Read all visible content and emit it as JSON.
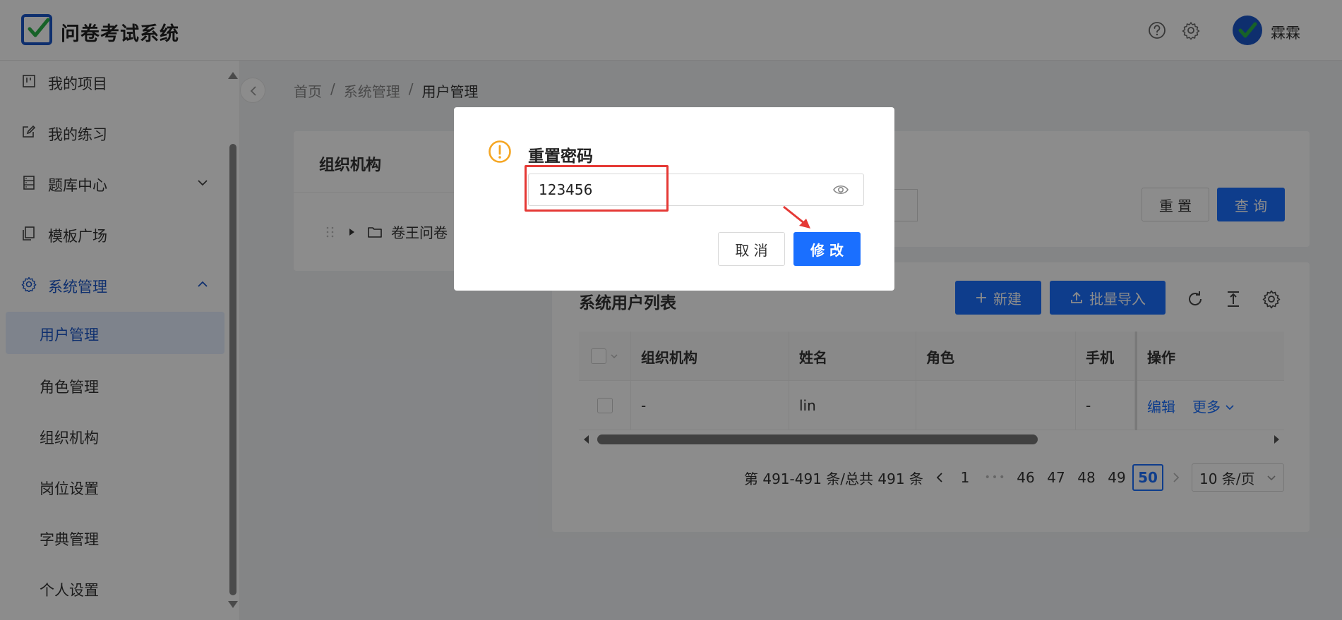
{
  "header": {
    "app_title": "问卷考试系统",
    "user_name": "霖霖"
  },
  "sidebar": {
    "items": [
      {
        "label": "我的项目"
      },
      {
        "label": "我的练习"
      },
      {
        "label": "题库中心"
      },
      {
        "label": "模板广场"
      },
      {
        "label": "系统管理"
      }
    ],
    "sub_items": [
      {
        "label": "用户管理"
      },
      {
        "label": "角色管理"
      },
      {
        "label": "组织机构"
      },
      {
        "label": "岗位设置"
      },
      {
        "label": "字典管理"
      },
      {
        "label": "个人设置"
      }
    ]
  },
  "breadcrumb": {
    "home": "首页",
    "sep": "/",
    "level1": "系统管理",
    "current": "用户管理"
  },
  "org_panel": {
    "title": "组织机构",
    "root_node": "卷王问卷"
  },
  "search": {
    "reset_label": "重 置",
    "query_label": "查 询"
  },
  "list": {
    "title": "系统用户列表",
    "new_label": "新建",
    "import_label": "批量导入"
  },
  "table": {
    "headers": [
      "组织机构",
      "姓名",
      "角色",
      "手机",
      "操作"
    ],
    "rows": [
      {
        "org": "-",
        "name": "lin",
        "role": "",
        "phone": "-",
        "edit": "编辑",
        "more": "更多"
      }
    ]
  },
  "pagination": {
    "summary": "第 491-491 条/总共 491 条",
    "pages": [
      "1",
      "46",
      "47",
      "48",
      "49",
      "50"
    ],
    "ellipsis": "•••",
    "current": "50",
    "page_size": "10 条/页"
  },
  "modal": {
    "title": "重置密码",
    "password_value": "123456",
    "cancel_label": "取 消",
    "ok_label": "修 改"
  },
  "colors": {
    "primary": "#1a6fff",
    "brand": "#1a56c9",
    "warning": "#f5a623",
    "highlight": "#e53935"
  }
}
